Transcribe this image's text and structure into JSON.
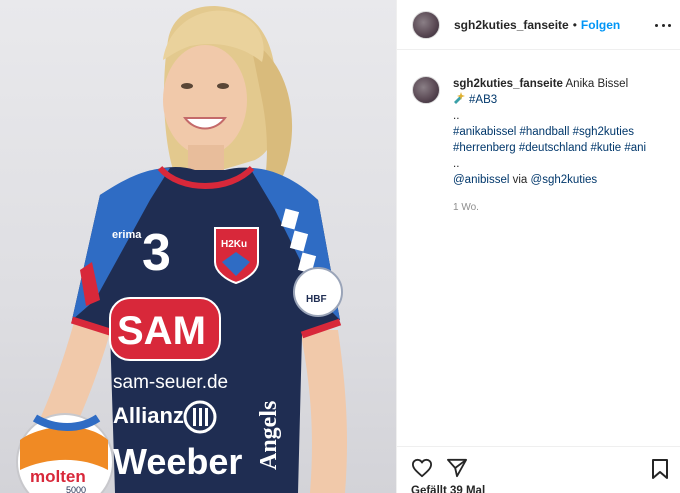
{
  "post": {
    "author": "sgh2kuties_fanseite",
    "separator": "•",
    "follow_label": "Folgen",
    "more_icon": "more-horizontal-icon"
  },
  "caption": {
    "author": "sgh2kuties_fanseite",
    "name": "Anika Bissel",
    "tag_emoji_icon": "sparkle-emoji-icon",
    "tag_ab3": "#AB3",
    "line_dots_1": "..",
    "hashtags": [
      "#anikabissel",
      "#handball",
      "#sgh2kuties",
      "#herrenberg",
      "#deutschland",
      "#kutie",
      "#ani"
    ],
    "line_dots_2": "..",
    "mention_1": "@anibissel",
    "via": "via",
    "mention_2": "@sgh2kuties",
    "timestamp": "1 Wo."
  },
  "actions": {
    "like_icon": "heart-icon",
    "share_icon": "paper-plane-icon",
    "save_icon": "bookmark-icon",
    "likes_text": "Gefällt 39 Mal"
  },
  "photo": {
    "jersey_number": "3",
    "brand": "erima",
    "crest": "H2Ku",
    "sponsor_main": "SAM",
    "sponsor_web": "sam-seuer.de",
    "sponsor_allianz": "Allianz",
    "sponsor_weeber": "Weeber",
    "sleeve_badge": "HBF",
    "sleeve_text": "Angels",
    "ball_brand": "molten",
    "ball_model": "5000",
    "colors": {
      "jersey_navy": "#1f2d52",
      "sleeve_blue": "#2f6cc4",
      "accent_red": "#d8283a",
      "hair_blonde": "#e3c98e",
      "skin": "#f1c9aa"
    }
  }
}
